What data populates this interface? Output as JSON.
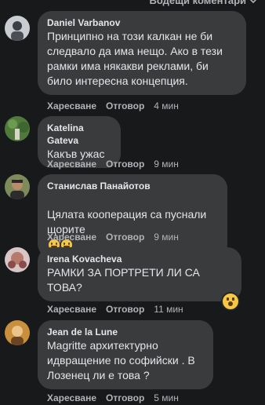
{
  "header": {
    "label": "Водещи коментари",
    "chevron": "chevron-down-icon"
  },
  "comments": [
    {
      "name": "Daniel Varbanov",
      "text": "Принципно на този калкан не би\nследвало да има нещо. Ако в тези\nрамки има някакви реклами, би\nбило интересна концепция.",
      "like": "Харесване",
      "reply": "Отговор",
      "time": "4 мин"
    },
    {
      "name": "Katelina Gateva",
      "text": "Какъв ужас",
      "like": "Харесване",
      "reply": "Отговор",
      "time": "9 мин"
    },
    {
      "name": "Станислав Панайотов",
      "text": "Цялата кооперация са пуснали\nщорите",
      "like": "Харесване",
      "reply": "Отговор",
      "time": "9 мин"
    },
    {
      "name": "Irena Kovacheva",
      "text": "РАМКИ ЗА ПОРТРЕТИ ЛИ СА\nТОВА?",
      "like": "Харесване",
      "reply": "Отговор",
      "time": "11 мин"
    },
    {
      "name": "Jean de la Lune",
      "text": "Magritte архитектурно\nидвращение по софийски . В\nЛозенец ли е това ?",
      "like": "Харесване",
      "reply": "Отговор",
      "time": "5 мин"
    }
  ],
  "colors": {
    "background": "#18191a",
    "bubble": "#3a3b3c",
    "text": "#e4e6eb",
    "muted": "#b0b3b8"
  }
}
